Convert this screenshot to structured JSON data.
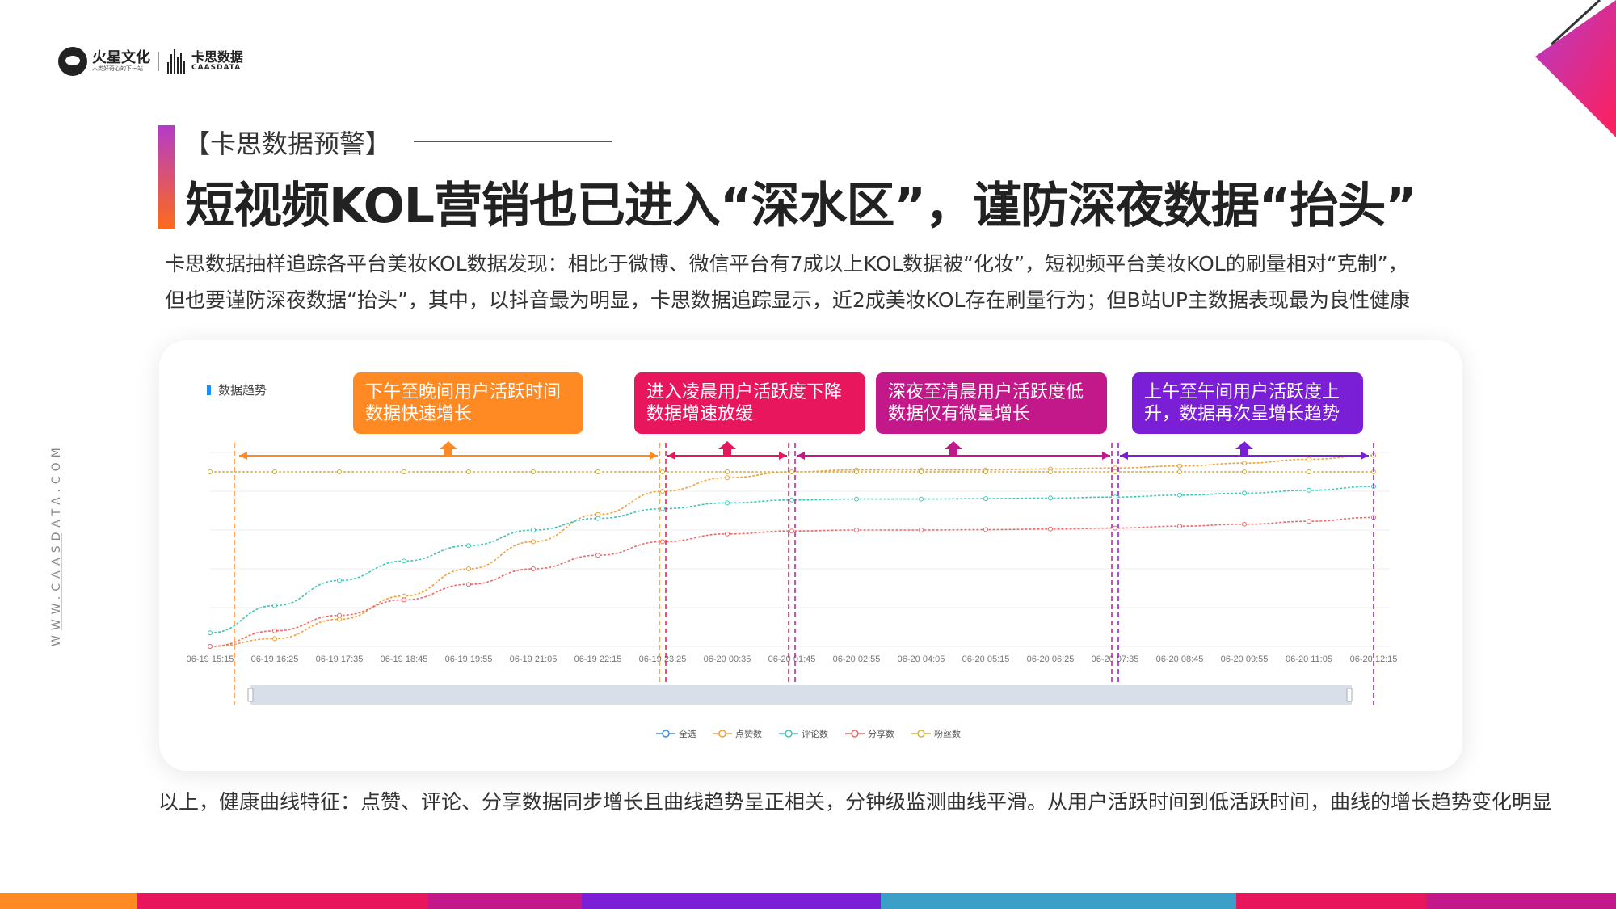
{
  "logo": {
    "brand": "火星文化",
    "tagline": "人类好奇心的下一站",
    "brand2": "卡思数据",
    "brand2_en": "CAASDATA"
  },
  "side_text": "WWW.CAASDATA.COM",
  "subtitle": "【卡思数据预警】",
  "title": "短视频KOL营销也已进入“深水区”，谨防深夜数据“抬头”",
  "desc": [
    "卡思数据抽样追踪各平台美妆KOL数据发现：相比于微博、微信平台有7成以上KOL数据被“化妆”，短视频平台美妆KOL的刷量相对“克制”，",
    "但也要谨防深夜数据“抬头”，其中，以抖音最为明显，卡思数据追踪显示，近2成美妆KOL存在刷量行为；但B站UP主数据表现最为良性健康"
  ],
  "chart_label": "数据趋势",
  "callouts": [
    {
      "text": "下午至晚间用户活跃时间数据快速增长",
      "line1": "下午至晚间用户活跃时间",
      "line2": "数据快速增长",
      "color": "#ff8a24"
    },
    {
      "text": "进入凌晨用户活跃度下降数据增速放缓",
      "line1": "进入凌晨用户活跃度下降",
      "line2": "数据增速放缓",
      "color": "#e8175d"
    },
    {
      "text": "深夜至清晨用户活跃度低数据仅有微量增长",
      "line1": "深夜至清晨用户活跃度低",
      "line2": "数据仅有微量增长",
      "color": "#c2188a"
    },
    {
      "text": "上午至午间用户活跃度上升，数据再次呈增长趋势",
      "line1": "上午至午间用户活跃度上",
      "line2": "升，数据再次呈增长趋势",
      "color": "#7b1fd6"
    }
  ],
  "chart_data": {
    "type": "line",
    "x_ticks": [
      "06-19 15:15",
      "06-19 16:25",
      "06-19 17:35",
      "06-19 18:45",
      "06-19 19:55",
      "06-19 21:05",
      "06-19 22:15",
      "06-19 23:25",
      "06-20 00:35",
      "06-20 01:45",
      "06-20 02:55",
      "06-20 04:05",
      "06-20 05:15",
      "06-20 06:25",
      "06-20 07:35",
      "06-20 08:45",
      "06-20 09:55",
      "06-20 11:05",
      "06-20 12:15"
    ],
    "y_normalized_range": [
      0,
      1
    ],
    "series": [
      {
        "name": "点赞数",
        "color": "#f0a13c",
        "values": [
          0.0,
          0.04,
          0.14,
          0.26,
          0.4,
          0.54,
          0.68,
          0.8,
          0.87,
          0.9,
          0.91,
          0.91,
          0.91,
          0.915,
          0.92,
          0.93,
          0.945,
          0.965,
          0.985
        ]
      },
      {
        "name": "评论数",
        "color": "#3cc6b8",
        "values": [
          0.07,
          0.21,
          0.34,
          0.44,
          0.52,
          0.6,
          0.66,
          0.71,
          0.74,
          0.755,
          0.76,
          0.76,
          0.762,
          0.765,
          0.77,
          0.78,
          0.79,
          0.805,
          0.825
        ]
      },
      {
        "name": "分享数",
        "color": "#ec6a6a",
        "values": [
          0.0,
          0.08,
          0.16,
          0.24,
          0.32,
          0.4,
          0.47,
          0.54,
          0.58,
          0.595,
          0.6,
          0.6,
          0.602,
          0.605,
          0.61,
          0.62,
          0.63,
          0.645,
          0.665
        ]
      },
      {
        "name": "粉丝数",
        "color": "#d4b23c",
        "values": [
          0.9,
          0.9,
          0.9,
          0.9,
          0.9,
          0.9,
          0.9,
          0.9,
          0.9,
          0.9,
          0.9,
          0.9,
          0.9,
          0.9,
          0.9,
          0.9,
          0.9,
          0.9,
          0.9
        ]
      }
    ],
    "legend": [
      "全选",
      "点赞数",
      "评论数",
      "分享数",
      "粉丝数"
    ],
    "legend_colors": [
      "#3a8ee6",
      "#f0a13c",
      "#3cc6b8",
      "#ec6a6a",
      "#d4b23c"
    ],
    "legend_position": "bottom-center",
    "phase_boundaries": [
      "06-19 15:15",
      "06-19 23:25",
      "06-20 01:45",
      "06-20 07:35",
      "06-20 12:15"
    ]
  },
  "conclusion": "以上，健康曲线特征：点赞、评论、分享数据同步增长且曲线趋势呈正相关，分钟级监测曲线平滑。从用户活跃时间到低活跃时间，曲线的增长趋势变化明显",
  "bottom_strip_colors": [
    "#ff8a24",
    "#e8175d",
    "#c2188a",
    "#7b1fd6",
    "#3aa0c8",
    "#e8175d",
    "#c2188a"
  ]
}
